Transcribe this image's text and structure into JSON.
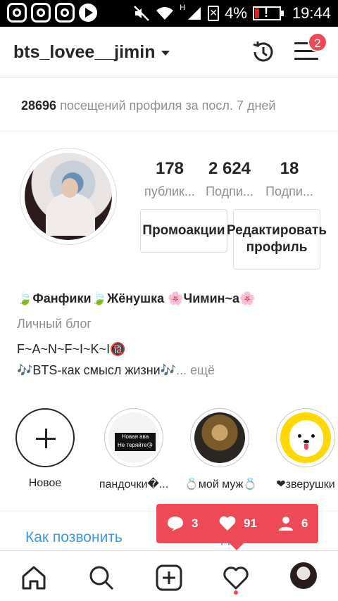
{
  "status_bar": {
    "icons": [
      "instagram-icon",
      "instagram-icon",
      "instagram-icon",
      "play-icon",
      "mute-icon",
      "wifi-icon",
      "signal-icon",
      "sim-icon",
      "battery-icon"
    ],
    "network": "H",
    "battery": "4%",
    "time": "19:44"
  },
  "header": {
    "username": "bts_lovee__jimin",
    "notifications_badge": "2"
  },
  "insights": {
    "visits_count": "28696",
    "visits_text": "посещений профиля за посл. 7 дней"
  },
  "stats": [
    {
      "value": "178",
      "label": "публик..."
    },
    {
      "value": "2 624",
      "label": "Подпи..."
    },
    {
      "value": "18",
      "label": "Подпи..."
    }
  ],
  "buttons": {
    "promotions": "Промоакции",
    "edit_profile": "Редактировать профиль"
  },
  "bio": {
    "name": "🍃Фанфики🍃Жёнушка 🌸Чимин~а🌸",
    "category": "Личный блог",
    "line1": "F~A~N~F~I~K~I🔞",
    "line2": "🎶BTS-как смысл жизни🎶",
    "more": "... ещё"
  },
  "highlights": [
    {
      "label": "Новое"
    },
    {
      "label": "пандочки�..."
    },
    {
      "label": "💍мой муж💍"
    },
    {
      "label": "❤зверушки"
    }
  ],
  "highlight_overlay": {
    "line1": "Новая ава",
    "line2": "Не теряйте😘"
  },
  "contact": {
    "call": "Как позвонить",
    "address": "Адрес"
  },
  "activity": {
    "comments": "3",
    "likes": "91",
    "follows": "6"
  },
  "colors": {
    "accent": "#ed4956",
    "link": "#3897f0",
    "secondary_text": "#8e8e8e"
  }
}
